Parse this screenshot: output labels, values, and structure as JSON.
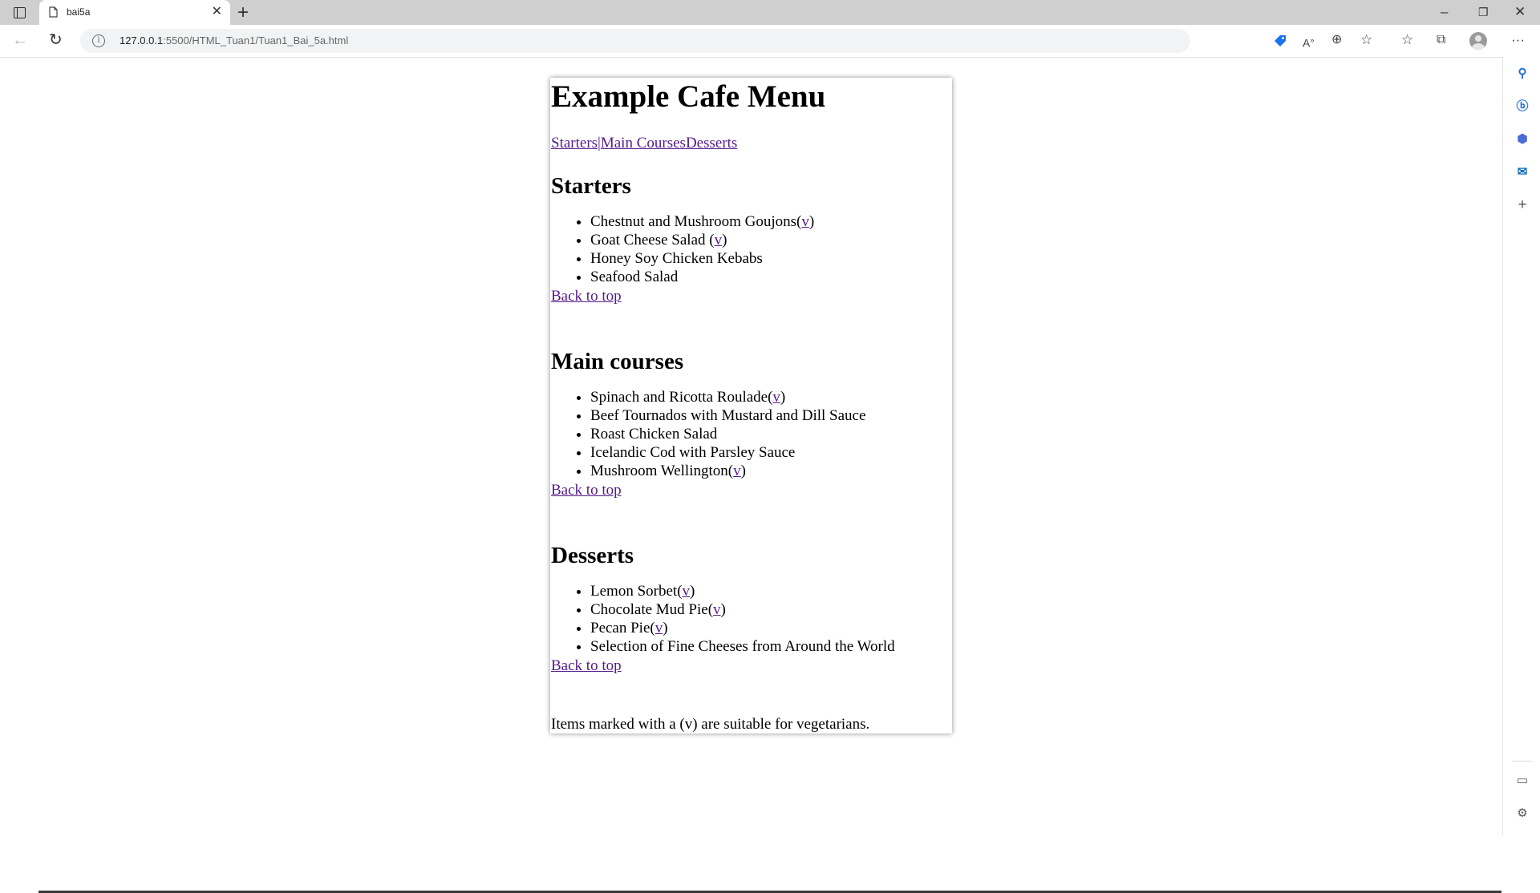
{
  "browser": {
    "tab_title": "bai5a",
    "url_host": "127.0.0.1",
    "url_rest": ":5500/HTML_Tuan1/Tuan1_Bai_5a.html"
  },
  "page": {
    "title": "Example Cafe Menu",
    "nav": [
      {
        "label": "Starters"
      },
      {
        "label": "Main Courses"
      },
      {
        "label": "Desserts"
      }
    ],
    "nav_separator": "|",
    "veg_marker": "v",
    "starters": {
      "heading": "Starters",
      "items": [
        {
          "name": "Chestnut and Mushroom Goujons",
          "veg": true,
          "space": false
        },
        {
          "name": "Goat Cheese Salad",
          "veg": true,
          "space": true
        },
        {
          "name": "Honey Soy Chicken Kebabs",
          "veg": false,
          "space": false
        },
        {
          "name": "Seafood Salad",
          "veg": false,
          "space": false
        }
      ]
    },
    "mains": {
      "heading": "Main courses",
      "items": [
        {
          "name": "Spinach and Ricotta Roulade",
          "veg": true,
          "space": false
        },
        {
          "name": "Beef Tournados with Mustard and Dill Sauce",
          "veg": false,
          "space": false
        },
        {
          "name": "Roast Chicken Salad",
          "veg": false,
          "space": false
        },
        {
          "name": "Icelandic Cod with Parsley Sauce",
          "veg": false,
          "space": false
        },
        {
          "name": "Mushroom Wellington",
          "veg": true,
          "space": false
        }
      ]
    },
    "desserts": {
      "heading": "Desserts",
      "items": [
        {
          "name": "Lemon Sorbet",
          "veg": true,
          "space": false
        },
        {
          "name": "Chocolate Mud Pie",
          "veg": true,
          "space": false
        },
        {
          "name": "Pecan Pie",
          "veg": true,
          "space": false
        },
        {
          "name": "Selection of Fine Cheeses from Around the World",
          "veg": false,
          "space": false
        }
      ]
    },
    "back_to_top": "Back to top",
    "footnote": "Items marked with a (v) are suitable for vegetarians."
  },
  "icons": {
    "tab_actions": "tab-actions-icon",
    "favicon": "page-icon",
    "close": "close-icon",
    "new_tab": "plus-icon",
    "back": "back-arrow-icon",
    "reload": "reload-icon",
    "site_info": "info-icon",
    "shopping": "tag-icon",
    "read_aloud": "read-aloud-icon",
    "zoom": "zoom-icon",
    "favorite": "star-plus-icon",
    "favorites": "favorites-icon",
    "collections": "collections-icon",
    "profile": "profile-avatar",
    "more": "more-icon",
    "side_search": "search-icon",
    "side_bing": "bing-icon",
    "side_office": "office-icon",
    "side_outlook": "outlook-icon",
    "side_add": "plus-icon",
    "side_panel": "panel-icon",
    "side_settings": "gear-icon"
  },
  "colors": {
    "link_visited": "#551a8b",
    "tabstrip": "#cfcfcf",
    "shopping_blue": "#1a73e8"
  }
}
